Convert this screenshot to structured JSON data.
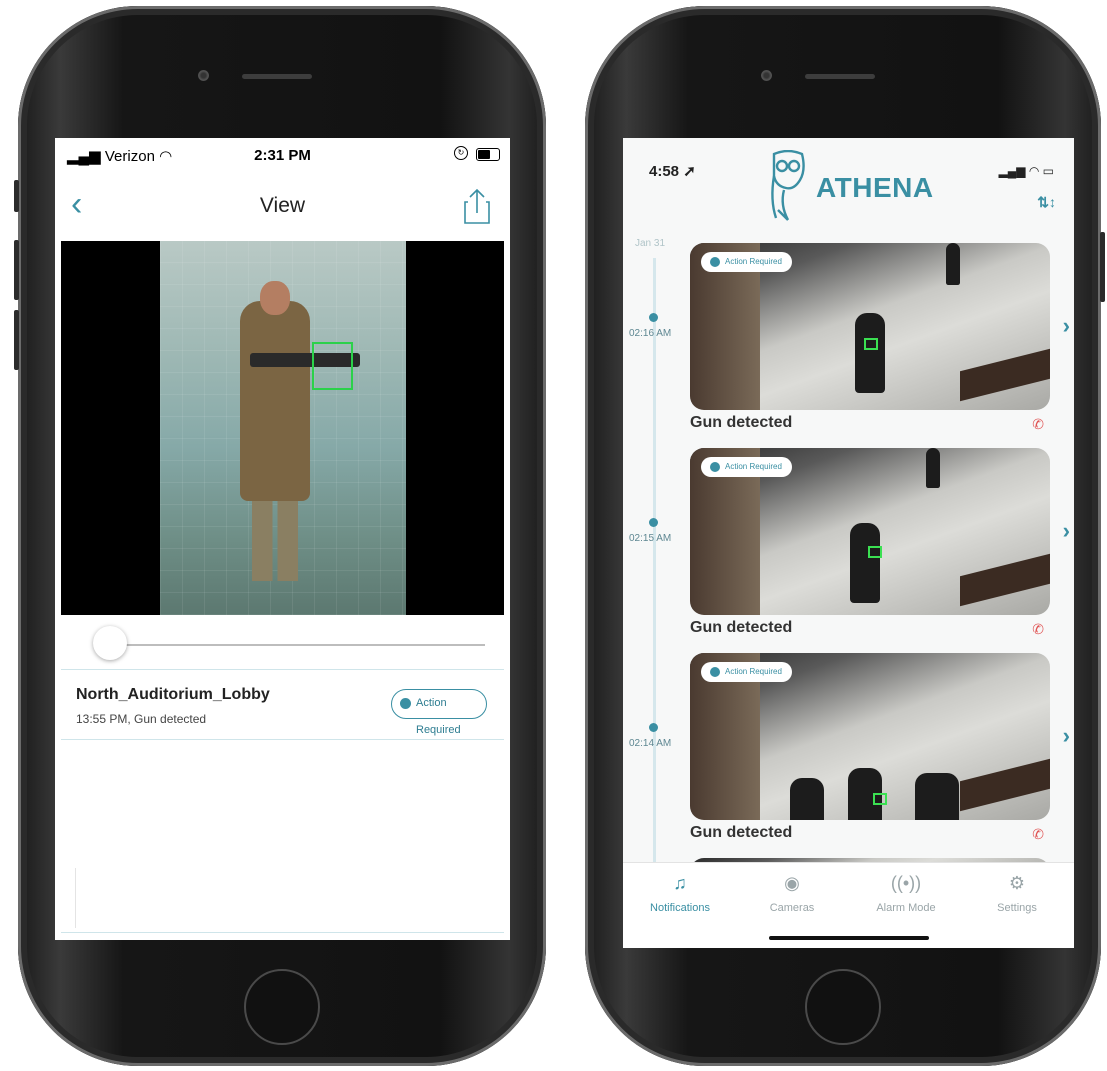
{
  "left": {
    "status": {
      "carrier": "Verizon",
      "time": "2:31 PM"
    },
    "nav": {
      "back": "<",
      "title": "View"
    },
    "clip": {
      "location": "North_Auditorium_Lobby",
      "detail": "13:55 PM, Gun detected",
      "action": "Action Required"
    },
    "playback": {
      "position": 0.03
    }
  },
  "right": {
    "status": {
      "time": "4:58"
    },
    "brand": "ATHENA",
    "date": "Jan 31",
    "alerts": [
      {
        "time": "02:16 AM",
        "badge": "Action Required",
        "caption": "Gun detected"
      },
      {
        "time": "02:15 AM",
        "badge": "Action Required",
        "caption": "Gun detected"
      },
      {
        "time": "02:14 AM",
        "badge": "Action Required",
        "caption": "Gun detected"
      }
    ],
    "tabs": [
      {
        "label": "Notifications",
        "icon": "bell-icon"
      },
      {
        "label": "Cameras",
        "icon": "eye-icon"
      },
      {
        "label": "Alarm Mode",
        "icon": "broadcast-icon"
      },
      {
        "label": "Settings",
        "icon": "gear-icon"
      }
    ]
  },
  "colors": {
    "accent": "#3a8fa3",
    "detection": "#2bd14a",
    "call": "#e05555"
  }
}
